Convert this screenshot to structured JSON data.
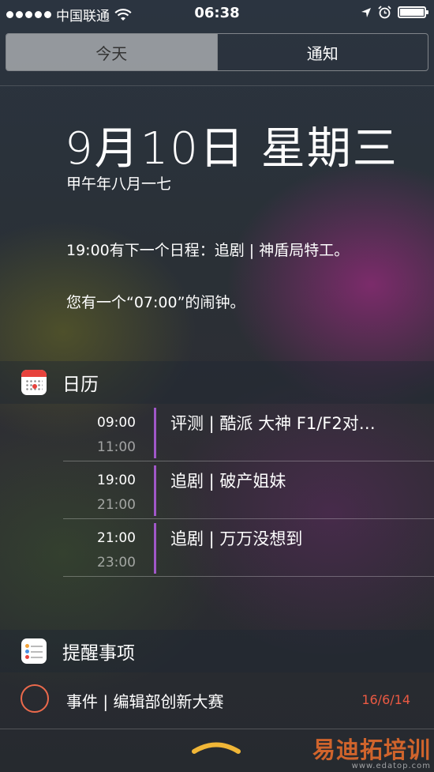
{
  "status_bar": {
    "carrier": "中国联通",
    "time": "06:38",
    "signal_bars": 5,
    "battery_level": 1.0
  },
  "tabs": [
    {
      "label": "今天",
      "selected": true
    },
    {
      "label": "通知",
      "selected": false
    }
  ],
  "today": {
    "date": "9月10日 星期三",
    "lunar_date": "甲午年八月一七",
    "next_event_summary": "19:00有下一个日程：追剧 | 神盾局特工。",
    "alarm_summary": "您有一个“07:00”的闹钟。"
  },
  "calendar": {
    "title": "日历",
    "icon": "calendar-icon",
    "accent_color": "#a057c8",
    "events": [
      {
        "start": "09:00",
        "end": "11:00",
        "title": "评测 | 酷派 大神 F1/F2对…"
      },
      {
        "start": "19:00",
        "end": "21:00",
        "title": "追剧 | 破产姐妹"
      },
      {
        "start": "21:00",
        "end": "23:00",
        "title": "追剧 | 万万没想到"
      }
    ]
  },
  "reminders": {
    "title": "提醒事项",
    "icon": "reminders-icon",
    "items": [
      {
        "title": "事件 | 编辑部创新大赛",
        "date": "16/6/14",
        "date_color": "#ec5a43"
      }
    ]
  },
  "watermark": {
    "text": "易迪拓培训",
    "url": "www.edatop.com"
  }
}
